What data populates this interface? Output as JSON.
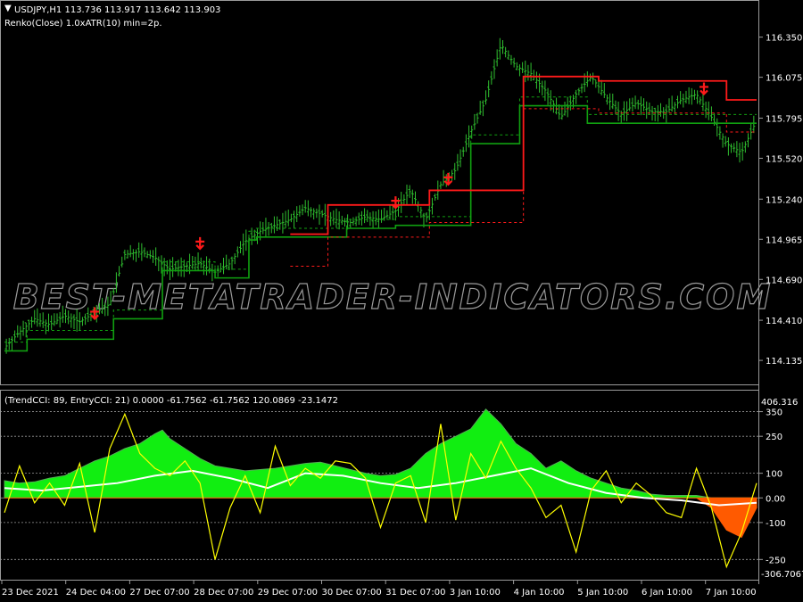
{
  "price_header": {
    "symbol_line": "USDJPY,H1  113.736 113.917 113.642 113.903",
    "renko_line": "Renko(Close) 1.0xATR(10) min=2p."
  },
  "indicator_header": "(TrendCCI: 89, EntryCCI: 21)  0.0000 -61.7562 -61.7562 120.0869 -23.1472",
  "watermark": "BEST-METATRADER-INDICATORS.COM",
  "colors": {
    "background": "#000000",
    "candles": "#2fbf2f",
    "support_line": "#10a010",
    "resistance_line": "#ff1a1a",
    "sell_arrow": "#ff1a1a",
    "trend_cci_fill_pos": "#11ee11",
    "trend_cci_fill_neg": "#ff5a00",
    "entry_cci_line": "#ffff00",
    "cci_ma_line": "#ffffff",
    "grid": "#9a9a9a"
  },
  "chart_data": [
    {
      "type": "line",
      "title": "USDJPY,H1",
      "price_axis_ticks": [
        "116.350",
        "116.075",
        "115.795",
        "115.520",
        "115.240",
        "114.965",
        "114.690",
        "114.410",
        "114.135"
      ],
      "ylim": [
        114.05,
        116.47
      ],
      "time_axis_labels": [
        "23 Dec 2021",
        "24 Dec 04:00",
        "27 Dec 07:00",
        "28 Dec 07:00",
        "29 Dec 07:00",
        "30 Dec 07:00",
        "31 Dec 07:00",
        "3 Jan 10:00",
        "4 Jan 10:00",
        "5 Jan 10:00",
        "6 Jan 10:00",
        "7 Jan 10:00"
      ],
      "series": [
        {
          "name": "price",
          "x": [
            0,
            4,
            8,
            12,
            16,
            20,
            24,
            28,
            32,
            36,
            40,
            44,
            48,
            52,
            56,
            60,
            64,
            68,
            72,
            76,
            80,
            84,
            88,
            92,
            96,
            100,
            104,
            108,
            112,
            116,
            120,
            124,
            128,
            132,
            136,
            140,
            144,
            148,
            152,
            156,
            160,
            164,
            168,
            172,
            176,
            180,
            184,
            188,
            192,
            196,
            200
          ],
          "values": [
            114.22,
            114.33,
            114.42,
            114.38,
            114.44,
            114.4,
            114.46,
            114.52,
            114.86,
            114.88,
            114.84,
            114.76,
            114.78,
            114.8,
            114.74,
            114.8,
            114.95,
            115.02,
            115.06,
            115.1,
            115.18,
            115.14,
            115.1,
            115.08,
            115.12,
            115.1,
            115.16,
            115.3,
            115.1,
            115.34,
            115.44,
            115.7,
            115.92,
            116.3,
            116.15,
            116.1,
            115.98,
            115.8,
            115.96,
            116.08,
            115.94,
            115.82,
            115.9,
            115.84,
            115.84,
            115.92,
            115.96,
            115.8,
            115.62,
            115.56,
            115.78
          ]
        },
        {
          "name": "support",
          "x": [
            0,
            6,
            6,
            29,
            29,
            42,
            42,
            56,
            56,
            65,
            65,
            67,
            67,
            91,
            91,
            104,
            104,
            124,
            124,
            137,
            137,
            155,
            155,
            200
          ],
          "values": [
            114.2,
            114.2,
            114.28,
            114.28,
            114.42,
            114.42,
            114.75,
            114.75,
            114.7,
            114.7,
            114.96,
            114.96,
            114.98,
            114.98,
            115.04,
            115.04,
            115.06,
            115.06,
            115.62,
            115.62,
            115.88,
            115.88,
            115.76,
            115.76
          ]
        },
        {
          "name": "resistance",
          "x": [
            76,
            86,
            86,
            113,
            113,
            138,
            138,
            158,
            158,
            192,
            192,
            200
          ],
          "values": [
            115.0,
            115.0,
            115.2,
            115.2,
            115.3,
            115.3,
            116.08,
            116.08,
            116.05,
            116.05,
            115.92,
            115.92
          ]
        }
      ],
      "sell_arrows": [
        {
          "x": 24,
          "price": 114.42
        },
        {
          "x": 52,
          "price": 114.9
        },
        {
          "x": 104,
          "price": 115.18
        },
        {
          "x": 118,
          "price": 115.34
        },
        {
          "x": 186,
          "price": 115.96
        }
      ]
    },
    {
      "type": "area",
      "title": "(TrendCCI: 89, EntryCCI: 21)",
      "level_ticks": [
        "350",
        "250",
        "100",
        "0.00",
        "-100",
        "-250"
      ],
      "scale_labels": [
        "406.316",
        "-306.7067"
      ],
      "ylim": [
        -306.7067,
        406.316
      ],
      "levels": [
        350,
        250,
        100,
        0,
        -100,
        -250
      ],
      "series": [
        {
          "name": "TrendCCI",
          "x": [
            0,
            4,
            8,
            12,
            16,
            20,
            24,
            28,
            32,
            36,
            40,
            42,
            44,
            48,
            52,
            56,
            60,
            64,
            68,
            72,
            76,
            80,
            84,
            88,
            92,
            96,
            100,
            104,
            108,
            112,
            116,
            120,
            124,
            128,
            132,
            136,
            140,
            144,
            148,
            152,
            156,
            160,
            164,
            168,
            172,
            176,
            180,
            184,
            188,
            192,
            196,
            200
          ],
          "values": [
            70,
            60,
            65,
            80,
            90,
            120,
            150,
            170,
            200,
            220,
            260,
            275,
            240,
            200,
            160,
            130,
            120,
            110,
            115,
            120,
            130,
            140,
            145,
            130,
            115,
            100,
            90,
            95,
            120,
            180,
            220,
            250,
            280,
            360,
            300,
            220,
            180,
            120,
            150,
            110,
            80,
            60,
            40,
            30,
            15,
            10,
            10,
            10,
            -40,
            -130,
            -160,
            -40
          ]
        },
        {
          "name": "EntryCCI",
          "x": [
            0,
            4,
            8,
            12,
            16,
            20,
            24,
            28,
            32,
            36,
            40,
            44,
            48,
            52,
            56,
            60,
            64,
            68,
            72,
            76,
            80,
            84,
            88,
            92,
            96,
            100,
            104,
            108,
            112,
            116,
            120,
            124,
            128,
            132,
            136,
            140,
            144,
            148,
            152,
            156,
            160,
            164,
            168,
            172,
            176,
            180,
            184,
            188,
            192,
            196,
            200
          ],
          "values": [
            -60,
            130,
            -20,
            60,
            -30,
            140,
            -140,
            200,
            340,
            180,
            120,
            90,
            150,
            60,
            -250,
            -40,
            90,
            -60,
            210,
            50,
            120,
            80,
            150,
            140,
            80,
            -120,
            60,
            90,
            -100,
            300,
            -90,
            180,
            80,
            230,
            120,
            40,
            -80,
            -30,
            -220,
            30,
            110,
            -20,
            60,
            10,
            -60,
            -80,
            120,
            -40,
            -280,
            -140,
            60
          ]
        },
        {
          "name": "CCI average",
          "x": [
            0,
            10,
            20,
            30,
            40,
            50,
            60,
            70,
            80,
            90,
            100,
            110,
            120,
            130,
            140,
            150,
            160,
            170,
            180,
            190,
            200
          ],
          "values": [
            40,
            30,
            45,
            60,
            90,
            110,
            80,
            40,
            100,
            90,
            60,
            40,
            60,
            90,
            120,
            60,
            20,
            0,
            -10,
            -30,
            -20
          ]
        }
      ]
    }
  ]
}
